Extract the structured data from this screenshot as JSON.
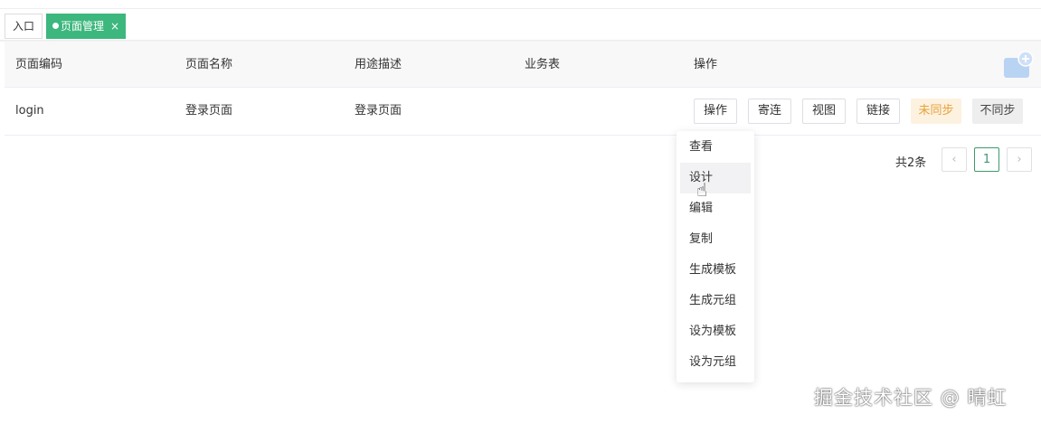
{
  "tabs": [
    {
      "label": "入口"
    },
    {
      "label": "页面管理",
      "close": "×"
    }
  ],
  "table": {
    "headers": [
      "页面编码",
      "页面名称",
      "用途描述",
      "业务表",
      "操作"
    ],
    "rows": [
      {
        "code": "login",
        "name": "登录页面",
        "desc": "登录页面",
        "table": ""
      }
    ],
    "actions": [
      "操作",
      "寄连",
      "视图",
      "链接",
      "未同步",
      "不同步"
    ]
  },
  "pagination": {
    "total": "共2条",
    "prev": "‹",
    "current": "1",
    "next": "›"
  },
  "menu": [
    "查看",
    "设计",
    "编辑",
    "复制",
    "生成模板",
    "生成元组",
    "设为模板",
    "设为元组"
  ],
  "watermark": "掘金技术社区 @ 晴虹",
  "colors": {
    "accent": "#3cb77d",
    "warning": "#e6a23c"
  }
}
